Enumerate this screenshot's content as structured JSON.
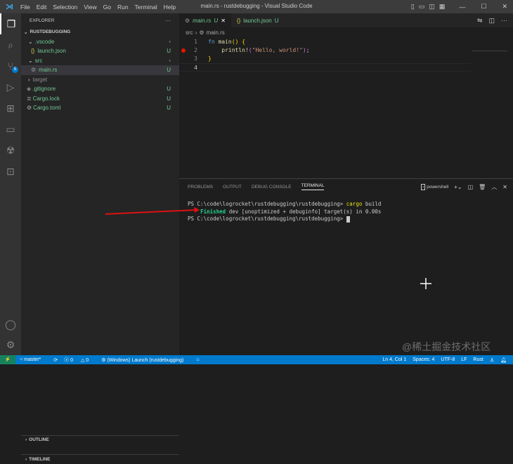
{
  "titlebar": {
    "menu": [
      "File",
      "Edit",
      "Selection",
      "View",
      "Go",
      "Run",
      "Terminal",
      "Help"
    ],
    "title": "main.rs - rustdebugging - Visual Studio Code"
  },
  "activity": {
    "scm_badge": "5"
  },
  "sidebar": {
    "header": "EXPLORER",
    "more": "···",
    "root": "RUSTDEBUGGING",
    "items": [
      {
        "label": ".vscode",
        "status": "•",
        "indent": 1,
        "type": "folder-open"
      },
      {
        "label": "launch.json",
        "status": "U",
        "indent": 2,
        "type": "json"
      },
      {
        "label": "src",
        "status": "•",
        "indent": 1,
        "type": "folder-open"
      },
      {
        "label": "main.rs",
        "status": "U",
        "indent": 2,
        "type": "rust",
        "selected": true
      },
      {
        "label": "target",
        "status": "",
        "indent": 1,
        "type": "folder"
      },
      {
        "label": ".gitignore",
        "status": "U",
        "indent": 1,
        "type": "file"
      },
      {
        "label": "Cargo.lock",
        "status": "U",
        "indent": 1,
        "type": "file"
      },
      {
        "label": "Cargo.toml",
        "status": "U",
        "indent": 1,
        "type": "gear"
      }
    ],
    "outline": "OUTLINE",
    "timeline": "TIMELINE"
  },
  "editor": {
    "tabs": [
      {
        "label": "main.rs",
        "status": "U",
        "active": true
      },
      {
        "label": "launch.json",
        "status": "U"
      }
    ],
    "breadcrumb": [
      "src",
      "main.rs"
    ],
    "lines": [
      {
        "n": "1",
        "code": "fn main() {"
      },
      {
        "n": "2",
        "code": "    println!(\"Hello, world!\");",
        "breakpoint": true
      },
      {
        "n": "3",
        "code": "}"
      },
      {
        "n": "4",
        "code": ""
      }
    ]
  },
  "panel": {
    "tabs": [
      "PROBLEMS",
      "OUTPUT",
      "DEBUG CONSOLE",
      "TERMINAL"
    ],
    "shell": "powershell",
    "terminal": {
      "prompt": "PS C:\\code\\logrocket\\rustdebugging\\rustdebugging>",
      "cmd1": "cargo",
      "cmd1b": " build",
      "finished": "Finished",
      "rest": " dev [unoptimized + debuginfo] target(s) in 0.00s"
    }
  },
  "status": {
    "branch": "master*",
    "errors": "0",
    "warnings": "0",
    "launch": "(Windows) Launch (rustdebugging)",
    "position": "Ln 4, Col 1",
    "spaces": "Spaces: 4",
    "encoding": "UTF-8",
    "eol": "LF",
    "language": "Rust"
  },
  "watermark": "@稀土掘金技术社区"
}
